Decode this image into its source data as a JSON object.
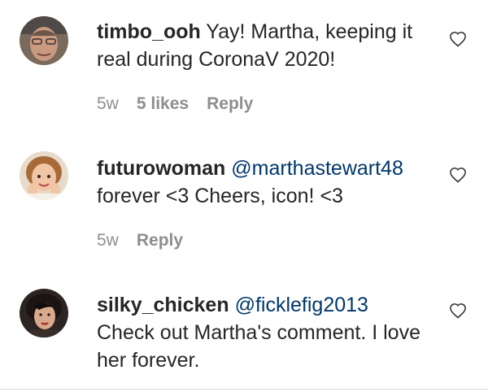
{
  "comments": [
    {
      "username": "timbo_ooh",
      "mention": "",
      "text": "Yay! Martha, keeping it real during CoronaV 2020!",
      "time": "5w",
      "likes": "5 likes",
      "reply": "Reply"
    },
    {
      "username": "futurowoman",
      "mention": "@marthastewart48",
      "text": "forever <3 Cheers, icon! <3",
      "time": "5w",
      "likes": "",
      "reply": "Reply"
    },
    {
      "username": "silky_chicken",
      "mention": "@ficklefig2013",
      "text": "Check out Martha's comment. I love her forever.",
      "time": "",
      "likes": "",
      "reply": ""
    }
  ],
  "icons": {
    "like": "heart-outline-icon"
  },
  "colors": {
    "text": "#262626",
    "secondary": "#8e8e8e",
    "mention": "#00376b",
    "divider": "#dbdbdb"
  }
}
